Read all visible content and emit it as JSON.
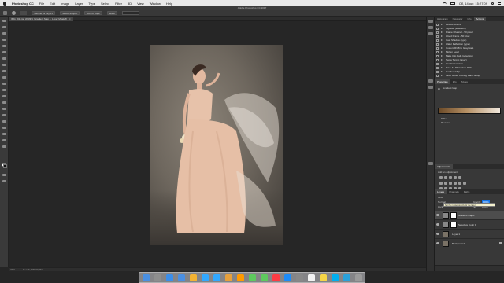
{
  "menubar": {
    "app_name": "Photoshop CC",
    "items": [
      "File",
      "Edit",
      "Image",
      "Layer",
      "Type",
      "Select",
      "Filter",
      "3D",
      "View",
      "Window",
      "Help"
    ],
    "clock": "Сб, 14 окт. 15:27:09"
  },
  "window": {
    "title": "Adobe Photoshop CC 2017"
  },
  "options_bar": {
    "sample_all_layers": "Sample All Layers",
    "refine": "Refine Edge",
    "select_subject": "Select Subject",
    "mask": "Mask"
  },
  "document": {
    "tab_title": "IMG_238.jpg @ 33% (Gradient Map 1, Layer Mask/8)",
    "zoom": "33%",
    "doc_size": "Doc: 6,49M/30,5M"
  },
  "right_panels": {
    "top_tabs": [
      "Histogram",
      "Navigator",
      "Info",
      "Actions"
    ],
    "actions": [
      "Default Actions",
      "Vignette (selection)",
      "Frame Channel - 50 pixel",
      "Wood Frame - 50 pixel",
      "Cast Shadow (type)",
      "Water Reflection (type)",
      "Custom RGB to Grayscale",
      "Molten Lead",
      "Make Clip Path (selection)",
      "Sepia Toning (layer)",
      "Quadrant Colors",
      "Save As Photoshop PDF",
      "Gradient Map",
      "Mixer Brush Cloning Paint Setup"
    ],
    "props_tabs": [
      "Properties",
      "Info",
      "Styles"
    ],
    "props_header": "Gradient Map",
    "dither_label": "Dither",
    "reverse_label": "Reverse",
    "adj_tabs": [
      "Adjustments"
    ],
    "adj_title": "Add an adjustment",
    "layers_tabs": [
      "Layers",
      "Channels",
      "Paths"
    ],
    "kind_label": "Kind",
    "blend_mode": "Normal",
    "opacity_label": "Opacity:",
    "opacity_value": "100%",
    "lock_label": "Lock:",
    "fill_label": "Fill:",
    "fill_value": "100%",
    "tooltip": "Set the master opacity for the layer",
    "layers": [
      {
        "name": "Gradient Map 1",
        "selected": true
      },
      {
        "name": "Selective Color 1",
        "selected": false
      },
      {
        "name": "Layer 1",
        "selected": false
      },
      {
        "name": "Background",
        "selected": false
      }
    ]
  },
  "colors": {
    "ui_dark": "#262626",
    "panel": "#383838",
    "accent": "#1473e6",
    "gradient_start": "#6b4a28",
    "gradient_end": "#f0e7dc"
  },
  "dock": {
    "apps": [
      "finder",
      "launchpad",
      "safari",
      "mail",
      "photos",
      "photoshop",
      "lightroom",
      "bridge",
      "illustrator",
      "messages",
      "facetime",
      "music",
      "app-store",
      "system-preferences",
      "calendar",
      "notes",
      "skype",
      "telegram",
      "trash"
    ]
  }
}
